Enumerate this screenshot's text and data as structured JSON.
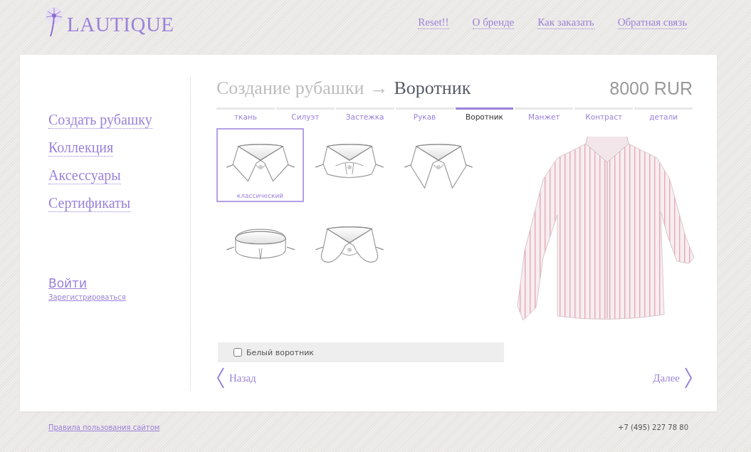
{
  "header": {
    "logo": "LAUTIQUE",
    "links": [
      "Reset!!",
      "О бренде",
      "Как заказать",
      "Обратная связь"
    ]
  },
  "sidebar": {
    "menu": [
      "Создать рубашку",
      "Коллекция",
      "Аксессуары",
      "Сертификаты"
    ],
    "login": "Войти",
    "register": "Зарегистрироваться"
  },
  "title": {
    "crumb": "Создание рубашки",
    "arrow": "→",
    "current": "Воротник",
    "price": "8000 RUR"
  },
  "tabs": [
    {
      "label": "ткань",
      "selected": false
    },
    {
      "label": "Силуэт",
      "selected": false
    },
    {
      "label": "Застежка",
      "selected": false
    },
    {
      "label": "Рукав",
      "selected": false
    },
    {
      "label": "Воротник",
      "selected": true
    },
    {
      "label": "Манжет",
      "selected": false
    },
    {
      "label": "Контраст",
      "selected": false
    },
    {
      "label": "детали",
      "selected": false
    }
  ],
  "collars": [
    {
      "kind": "classic",
      "label": "классический",
      "selected": true
    },
    {
      "kind": "cutaway",
      "selected": false
    },
    {
      "kind": "longpoint",
      "selected": false
    },
    {
      "kind": "band",
      "selected": false
    },
    {
      "kind": "rounded",
      "selected": false
    }
  ],
  "white_collar": {
    "label": "Белый воротник",
    "checked": false
  },
  "nav": {
    "back": "Назад",
    "next": "Далее"
  },
  "footer": {
    "rules": "Правила пользования сайтом",
    "phone": "+7 (495) 227 78 80"
  }
}
